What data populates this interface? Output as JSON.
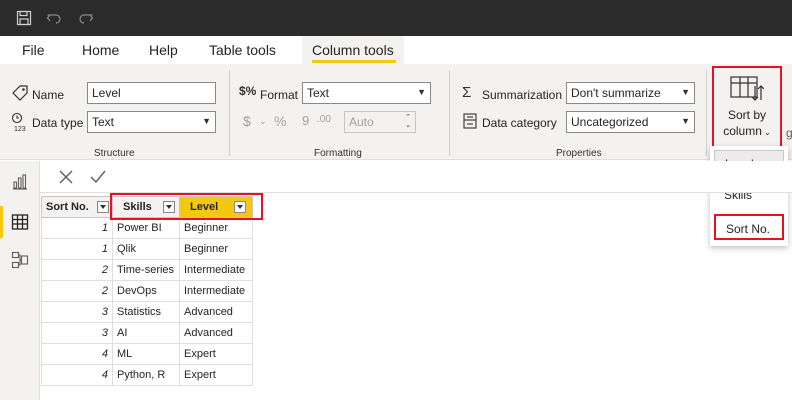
{
  "titlebar": {
    "icons": [
      "save-icon",
      "undo-icon",
      "redo-icon"
    ]
  },
  "menu": {
    "tabs": [
      "File",
      "Home",
      "Help",
      "Table tools",
      "Column tools"
    ],
    "active": "Column tools"
  },
  "structure": {
    "name_label": "Name",
    "name_value": "Level",
    "datatype_label": "Data type",
    "datatype_value": "Text",
    "group_label": "Structure"
  },
  "formatting": {
    "format_label": "Format",
    "format_value": "Text",
    "currency_symbol": "$",
    "percent_symbol": "%",
    "comma_symbol": "9",
    "decimal_symbol": ".00",
    "decimal_places": "Auto",
    "group_label": "Formatting"
  },
  "properties": {
    "summarization_label": "Summarization",
    "summarization_value": "Don't summarize",
    "category_label": "Data category",
    "category_value": "Uncategorized",
    "group_label": "Properties"
  },
  "sort_by": {
    "label_line1": "Sort by",
    "label_line2": "column",
    "overflow_glyph": "g",
    "options": [
      "Level",
      "Skills",
      "Sort No."
    ],
    "selected": "Level",
    "highlighted": "Sort No."
  },
  "table": {
    "columns": [
      "Sort No.",
      "Skills",
      "Level"
    ],
    "rows": [
      [
        "1",
        "Power BI",
        "Beginner"
      ],
      [
        "1",
        "Qlik",
        "Beginner"
      ],
      [
        "2",
        "Time-series",
        "Intermediate"
      ],
      [
        "2",
        "DevOps",
        "Intermediate"
      ],
      [
        "3",
        "Statistics",
        "Advanced"
      ],
      [
        "3",
        "AI",
        "Advanced"
      ],
      [
        "4",
        "ML",
        "Expert"
      ],
      [
        "4",
        "Python, R",
        "Expert"
      ]
    ]
  },
  "colors": {
    "accent": "#f2c811",
    "highlight": "#e81123",
    "titlebar": "#2b2b2b",
    "ribbon": "#f3f2f1"
  }
}
